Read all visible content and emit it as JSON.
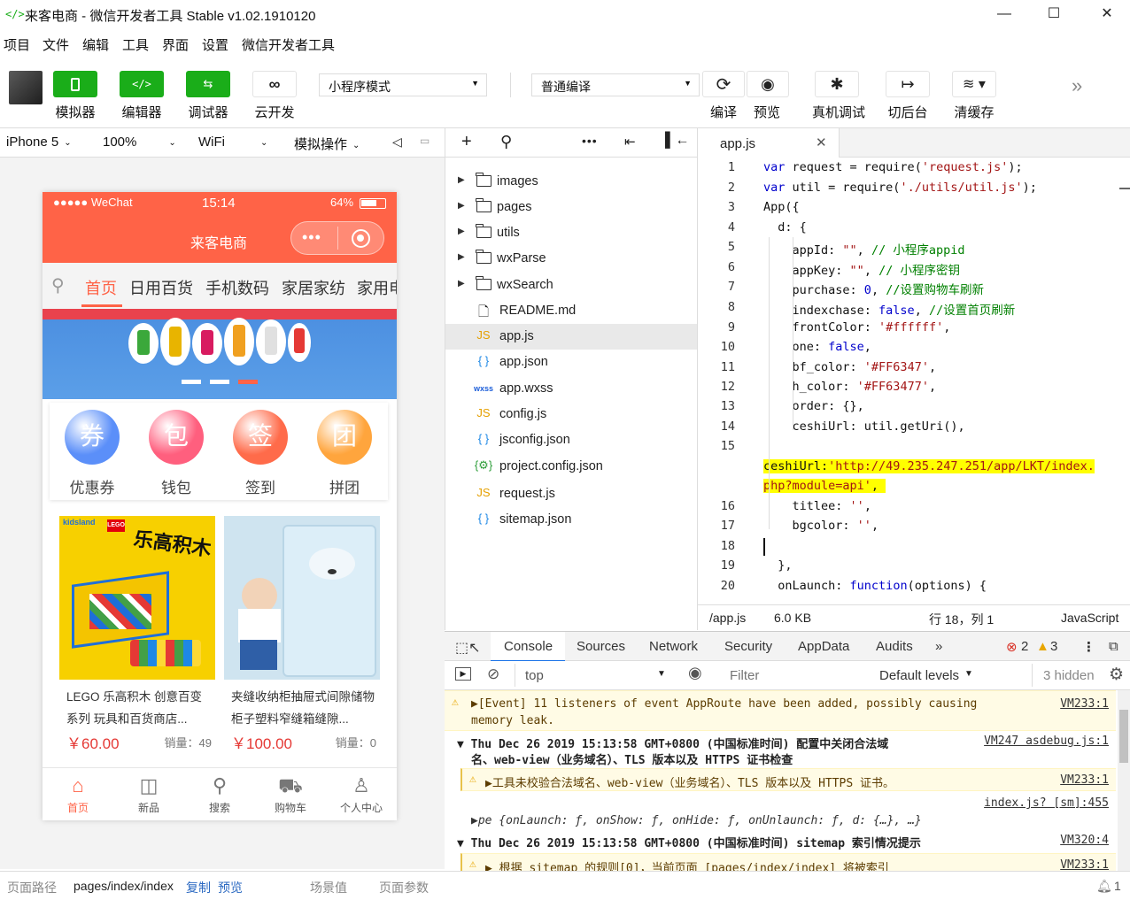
{
  "window": {
    "title": "来客电商 - 微信开发者工具 Stable v1.02.1910120",
    "minimize": "—",
    "maximize": "☐",
    "close": "✕"
  },
  "menu": [
    "项目",
    "文件",
    "编辑",
    "工具",
    "界面",
    "设置",
    "微信开发者工具"
  ],
  "toolbar": {
    "simulator": "模拟器",
    "editor": "编辑器",
    "debugger": "调试器",
    "cloud": "云开发",
    "mode": "小程序模式",
    "compile_mode": "普通编译",
    "compile": "编译",
    "preview": "预览",
    "remote_debug": "真机调试",
    "background": "切后台",
    "clear_cache": "清缓存"
  },
  "devicebar": {
    "device": "iPhone 5",
    "zoom": "100%",
    "network": "WiFi",
    "action": "模拟操作"
  },
  "phone": {
    "carrier": "●●●●● WeChat",
    "time": "15:14",
    "battery": "64%",
    "nav_title": "来客电商",
    "tabs": [
      "首页",
      "日用百货",
      "手机数码",
      "家居家纺",
      "家用电器"
    ],
    "icons": [
      {
        "glyph": "券",
        "label": "优惠券",
        "color": "#5b8ff9"
      },
      {
        "glyph": "包",
        "label": "钱包",
        "color": "#ff5f7e"
      },
      {
        "glyph": "签",
        "label": "签到",
        "color": "#ff6b4a"
      },
      {
        "glyph": "团",
        "label": "拼团",
        "color": "#ffa53d"
      }
    ],
    "products": [
      {
        "name": "LEGO 乐高积木 创意百变系列 玩具和百货商店...",
        "price": "￥60.00",
        "sales": "销量：49",
        "img_text": "乐高积木"
      },
      {
        "name": "夹缝收纳柜抽屉式间隙储物柜子塑料窄缝箱缝隙...",
        "price": "￥100.00",
        "sales": "销量：0",
        "img_text": ""
      }
    ],
    "tabbar": [
      "首页",
      "新品",
      "搜索",
      "购物车",
      "个人中心"
    ]
  },
  "bottombar": {
    "path_label": "页面路径",
    "path": "pages/index/index",
    "copy": "复制",
    "preview": "预览",
    "scene": "场景值",
    "params": "页面参数",
    "notif": "1"
  },
  "files": [
    {
      "name": "images",
      "type": "folder"
    },
    {
      "name": "pages",
      "type": "folder"
    },
    {
      "name": "utils",
      "type": "folder"
    },
    {
      "name": "wxParse",
      "type": "folder"
    },
    {
      "name": "wxSearch",
      "type": "folder"
    },
    {
      "name": "README.md",
      "type": "doc"
    },
    {
      "name": "app.js",
      "type": "js"
    },
    {
      "name": "app.json",
      "type": "json"
    },
    {
      "name": "app.wxss",
      "type": "wxss"
    },
    {
      "name": "config.js",
      "type": "js"
    },
    {
      "name": "jsconfig.json",
      "type": "json"
    },
    {
      "name": "project.config.json",
      "type": "cfg"
    },
    {
      "name": "request.js",
      "type": "js"
    },
    {
      "name": "sitemap.json",
      "type": "json"
    }
  ],
  "editor": {
    "tab": "app.js",
    "status": {
      "file": "/app.js",
      "size": "6.0 KB",
      "pos": "行 18，列 1",
      "lang": "JavaScript"
    },
    "lines": [
      {
        "n": "1",
        "html": "<span class='kw'>var</span> request = require(<span class='st'>'request.js'</span>);"
      },
      {
        "n": "2",
        "html": "<span class='kw'>var</span> util = require(<span class='st'>'./utils/util.js'</span>);"
      },
      {
        "n": "3",
        "html": "App({"
      },
      {
        "n": "4",
        "html": "  d: {"
      },
      {
        "n": "5",
        "html": "    appId: <span class='st'>\"\"</span>, <span class='cm'>// 小程序appid</span>"
      },
      {
        "n": "6",
        "html": "    appKey: <span class='st'>\"\"</span>, <span class='cm'>// 小程序密钥</span>"
      },
      {
        "n": "7",
        "html": "    purchase: <span class='fl'>0</span>, <span class='cm'>//设置购物车刷新</span>"
      },
      {
        "n": "8",
        "html": "    indexchase: <span class='kw'>false</span>, <span class='cm'>//设置首页刷新</span>"
      },
      {
        "n": "9",
        "html": "    frontColor: <span class='st'>'#ffffff'</span>,"
      },
      {
        "n": "10",
        "html": "    one: <span class='kw'>false</span>,"
      },
      {
        "n": "11",
        "html": "    bf_color: <span class='st'>'#FF6347'</span>,"
      },
      {
        "n": "12",
        "html": "    h_color: <span class='st'>'#FF63477'</span>,"
      },
      {
        "n": "13",
        "html": "    order: {},"
      },
      {
        "n": "14",
        "html": "    ceshiUrl: util.getUri(),"
      },
      {
        "n": "15",
        "html": ""
      },
      {
        "n": "",
        "html": "<span class='hl'>ceshiUrl:<span class='st'>'http://49.235.247.251/app/LKT/index.</span></span>"
      },
      {
        "n": "",
        "html": "<span class='hl'><span class='st'>php?module=api'</span>, </span>"
      },
      {
        "n": "16",
        "html": "    titlee: <span class='st'>''</span>,"
      },
      {
        "n": "17",
        "html": "    bgcolor: <span class='st'>''</span>,"
      },
      {
        "n": "18",
        "html": ""
      },
      {
        "n": "19",
        "html": "  },"
      },
      {
        "n": "20",
        "html": "  onLaunch: <span class='kw'>function</span>(options) {"
      }
    ]
  },
  "devtools": {
    "tabs": [
      "Console",
      "Sources",
      "Network",
      "Security",
      "AppData",
      "Audits"
    ],
    "errors": "2",
    "warnings": "3",
    "context": "top",
    "filter_placeholder": "Filter",
    "levels": "Default levels",
    "hidden": "3 hidden",
    "messages": [
      {
        "type": "warn",
        "text": "▶[Event] 11 listeners of event AppRoute have been added, possibly causing",
        "text2": "memory leak.",
        "src": "VM233:1"
      },
      {
        "type": "group",
        "text": "▼ Thu Dec 26 2019 15:13:58 GMT+0800 (中国标准时间) 配置中关闭合法域",
        "text2": "名、web-view（业务域名）、TLS 版本以及 HTTPS 证书检查",
        "src": "VM247 asdebug.js:1"
      },
      {
        "type": "warn",
        "text": "▶工具未校验合法域名、web-view（业务域名）、TLS 版本以及 HTTPS 证书。",
        "src": "VM233:1"
      },
      {
        "type": "log",
        "text": "▶pe {onLaunch: ƒ, onShow: ƒ, onHide: ƒ, onUnlaunch: ƒ, d: {…}, …}",
        "src": "index.js? [sm]:455"
      },
      {
        "type": "group",
        "text": "▼ Thu Dec 26 2019 15:13:58 GMT+0800 (中国标准时间) sitemap 索引情况提示",
        "src": "VM320:4"
      },
      {
        "type": "warn",
        "text": "▶ 根据 sitemap 的规则[0]，当前页面 [pages/index/index] 将被索引",
        "src": "VM233:1"
      }
    ]
  }
}
